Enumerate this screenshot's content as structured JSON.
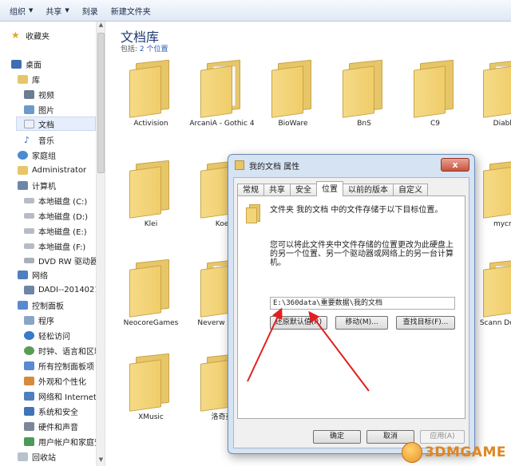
{
  "toolbar": {
    "organize": "组织",
    "share": "共享",
    "burn": "刻录",
    "new_folder": "新建文件夹"
  },
  "nav": {
    "favorites": "收藏夹",
    "desktop": "桌面",
    "libraries": "库",
    "videos": "视频",
    "pictures": "图片",
    "documents": "文档",
    "music": "音乐",
    "homegroup": "家庭组",
    "administrator": "Administrator",
    "computer": "计算机",
    "disk_c": "本地磁盘 (C:)",
    "disk_d": "本地磁盘 (D:)",
    "disk_e": "本地磁盘 (E:)",
    "disk_f": "本地磁盘 (F:)",
    "dvd": "DVD RW 驱动器",
    "network": "网络",
    "dadi": "DADI--2014021",
    "control_panel": "控制面板",
    "programs": "程序",
    "ease_of_access": "轻松访问",
    "clock_region": "时钟、语言和区域",
    "all_items": "所有控制面板项",
    "appearance": "外观和个性化",
    "network_internet": "网络和 Internet",
    "system_security": "系统和安全",
    "hardware_sound": "硬件和声音",
    "user_accounts": "用户帐户和家庭安全",
    "recycle_bin": "回收站"
  },
  "library": {
    "title": "文档库",
    "includes_label": "包括:",
    "includes_link": "2 个位置"
  },
  "folders": [
    "Activision",
    "ArcaniA - Gothic 4",
    "BioWare",
    "BnS",
    "C9",
    "Diablo",
    "Klei",
    "Koe",
    "mycro",
    "NeocoreGames",
    "Neverw Night",
    "Scann Docum",
    "XMusic",
    "洛奇英"
  ],
  "dialog": {
    "title": "我的文档 属性",
    "close": "x",
    "tabs": [
      "常规",
      "共享",
      "安全",
      "位置",
      "以前的版本",
      "自定义"
    ],
    "active_tab": "位置",
    "desc1": "文件夹 我的文档 中的文件存储于以下目标位置。",
    "desc2": "您可以将此文件夹中文件存储的位置更改为此硬盘上的另一个位置、另一个驱动器或网络上的另一台计算机。",
    "path_value": "E:\\360data\\重要数据\\我的文档",
    "restore_default": "还原默认值(R)",
    "move": "移动(M)...",
    "find_target": "查找目标(F)...",
    "ok": "确定",
    "cancel": "取消",
    "apply": "应用(A)"
  },
  "watermark": {
    "text": "3DMGAME"
  },
  "colors": {
    "folder_yellow": "#f0cd6a",
    "annotation_red": "#e02020",
    "title_blue": "#1e3a70",
    "link_blue": "#2a5bb7"
  }
}
